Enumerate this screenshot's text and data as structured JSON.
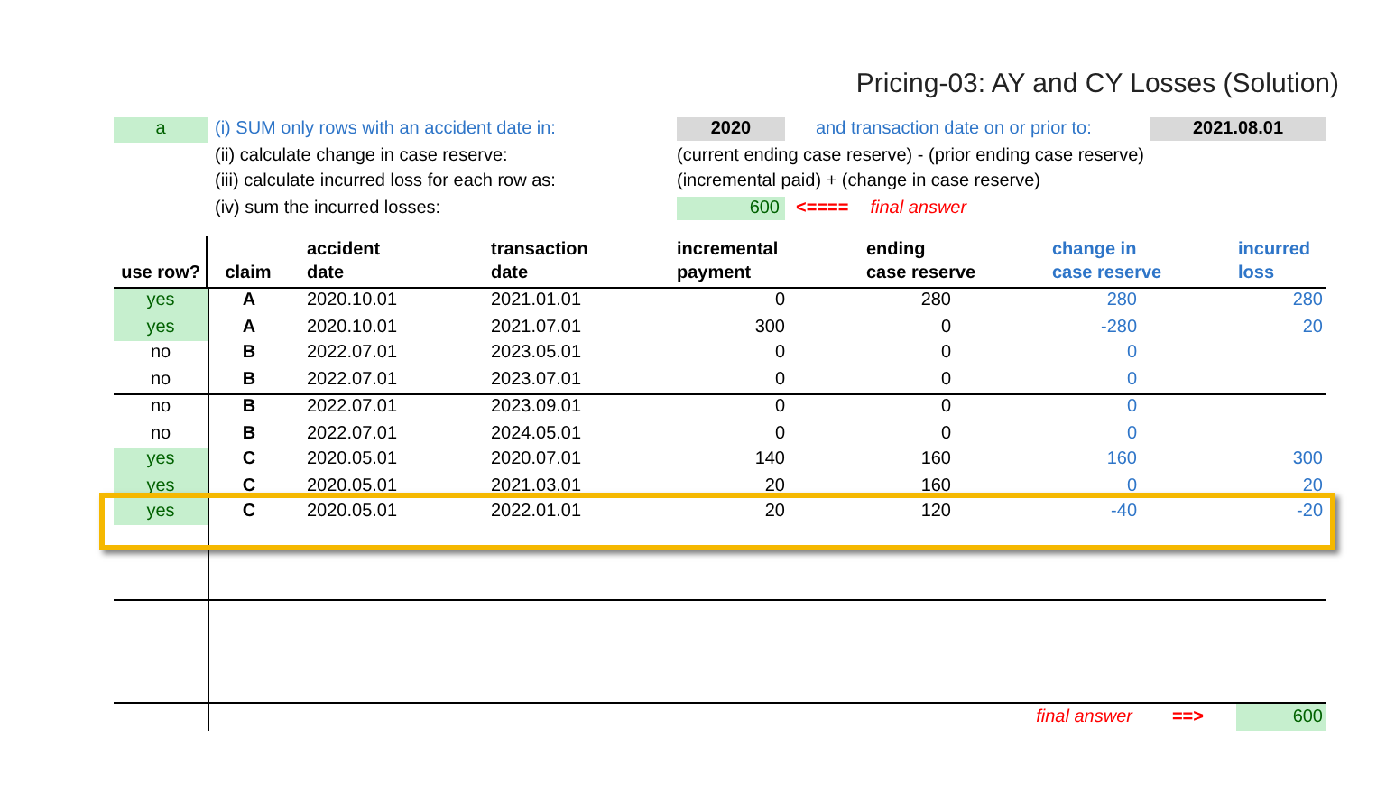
{
  "title": "Pricing-03: AY and CY Losses (Solution)",
  "instructions": {
    "tag": "a",
    "lines": [
      {
        "label": "(i)  SUM only rows with an accident date in:",
        "kind": "filter",
        "value": "2020",
        "extra": "and transaction date on or prior to:",
        "extra_value": "2021.08.01"
      },
      {
        "label": "(ii)  calculate change in case reserve:",
        "kind": "formula",
        "value": "(current ending case reserve) - (prior ending case reserve)"
      },
      {
        "label": "(iii) calculate incurred loss for each row as:",
        "kind": "formula",
        "value": "(incremental paid) + (change in case reserve)"
      },
      {
        "label": "(iv)  sum the incurred losses:",
        "kind": "answer",
        "value": "600",
        "arrow": "<====",
        "note": "final answer"
      }
    ]
  },
  "table": {
    "columns": [
      {
        "lines": [
          "use row?"
        ],
        "kind": "input"
      },
      {
        "lines": [
          "claim"
        ],
        "kind": "input"
      },
      {
        "lines": [
          "accident",
          "date"
        ],
        "kind": "input"
      },
      {
        "lines": [
          "transaction",
          "date"
        ],
        "kind": "input"
      },
      {
        "lines": [
          "incremental",
          "payment"
        ],
        "kind": "input"
      },
      {
        "lines": [
          "ending",
          "case reserve"
        ],
        "kind": "input"
      },
      {
        "lines": [
          "change in",
          "case reserve"
        ],
        "kind": "computed"
      },
      {
        "lines": [
          "incurred",
          "loss"
        ],
        "kind": "computed"
      }
    ],
    "row_groups": [
      [
        {
          "use": "yes",
          "used": true,
          "highlighted": false,
          "cells": [
            "A",
            "2020.10.01",
            "2021.01.01",
            "0",
            "280",
            "280",
            "280"
          ]
        },
        {
          "use": "yes",
          "used": true,
          "highlighted": false,
          "cells": [
            "A",
            "2020.10.01",
            "2021.07.01",
            "300",
            "0",
            "-280",
            "20"
          ]
        },
        {
          "use": "no",
          "used": false,
          "highlighted": false,
          "cells": [
            "B",
            "2022.07.01",
            "2023.05.01",
            "0",
            "0",
            "0",
            ""
          ]
        },
        {
          "use": "no",
          "used": false,
          "highlighted": false,
          "cells": [
            "B",
            "2022.07.01",
            "2023.07.01",
            "0",
            "0",
            "0",
            ""
          ]
        }
      ],
      [
        {
          "use": "no",
          "used": false,
          "highlighted": false,
          "cells": [
            "B",
            "2022.07.01",
            "2023.09.01",
            "0",
            "0",
            "0",
            ""
          ]
        },
        {
          "use": "no",
          "used": false,
          "highlighted": false,
          "cells": [
            "B",
            "2022.07.01",
            "2024.05.01",
            "0",
            "0",
            "0",
            ""
          ]
        },
        {
          "use": "yes",
          "used": true,
          "highlighted": false,
          "cells": [
            "C",
            "2020.05.01",
            "2020.07.01",
            "140",
            "160",
            "160",
            "300"
          ]
        },
        {
          "use": "yes",
          "used": true,
          "highlighted": false,
          "cells": [
            "C",
            "2020.05.01",
            "2021.03.01",
            "20",
            "160",
            "0",
            "20"
          ]
        },
        {
          "use": "yes",
          "used": true,
          "highlighted": true,
          "cells": [
            "C",
            "2020.05.01",
            "2022.01.01",
            "20",
            "120",
            "-40",
            "-20"
          ]
        }
      ]
    ]
  },
  "footer": {
    "label": "final answer",
    "arrow": "==>",
    "value": "600"
  }
}
